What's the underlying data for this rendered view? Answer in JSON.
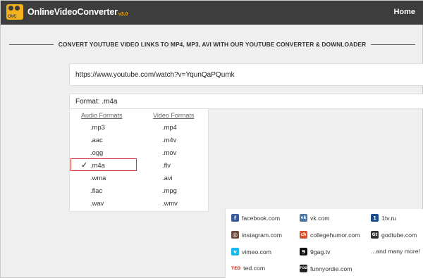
{
  "header": {
    "logo": {
      "badge": "OVC",
      "name": "OnlineVideoConverter",
      "version": "v3.0"
    },
    "nav_home": "Home",
    "badge_color": "#f3b11b",
    "bar_color": "#3d3d3d"
  },
  "headline": "CONVERT YOUTUBE VIDEO LINKS TO MP4, MP3, AVI WITH OUR YOUTUBE CONVERTER & DOWNLOADER",
  "url_input": {
    "value": "https://www.youtube.com/watch?v=YqunQaPQumk"
  },
  "format_select": {
    "label": "Format: .m4a",
    "selected": ".m4a"
  },
  "format_panel": {
    "audio_heading": "Audio Formats",
    "video_heading": "Video Formats",
    "audio": [
      ".mp3",
      ".aac",
      ".ogg",
      ".m4a",
      ".wma",
      ".flac",
      ".wav"
    ],
    "video": [
      ".mp4",
      ".m4v",
      ".mov",
      ".flv",
      ".avi",
      ".mpg",
      ".wmv"
    ],
    "check_mark": "✓",
    "highlight_color": "#d9382f"
  },
  "sites": [
    {
      "label": "facebook.com",
      "icon": "facebook-icon",
      "glyph": "f",
      "color": "#3b5998"
    },
    {
      "label": "vk.com",
      "icon": "vk-icon",
      "glyph": "vk",
      "color": "#4c75a3"
    },
    {
      "label": "1tv.ru",
      "icon": "1tv-icon",
      "glyph": "1",
      "color": "#1b4c8c"
    },
    {
      "label": "instagram.com",
      "icon": "instagram-icon",
      "glyph": "◎",
      "color": "#6b4a3a"
    },
    {
      "label": "collegehumor.com",
      "icon": "collegehumor-icon",
      "glyph": "ch",
      "color": "#d6502a"
    },
    {
      "label": "godtube.com",
      "icon": "godtube-icon",
      "glyph": "Gt",
      "color": "#333333"
    },
    {
      "label": "vimeo.com",
      "icon": "vimeo-icon",
      "glyph": "v",
      "color": "#1ab7ea"
    },
    {
      "label": "9gag.tv",
      "icon": "9gag-icon",
      "glyph": "9",
      "color": "#111111"
    },
    {
      "label": "...and many more!",
      "icon": "",
      "glyph": "",
      "color": ""
    },
    {
      "label": "ted.com",
      "icon": "ted-icon",
      "glyph": "TED",
      "color": "#e62b1e"
    },
    {
      "label": "funnyordie.com",
      "icon": "funnyordie-icon",
      "glyph": "FOD",
      "color": "#222222"
    }
  ]
}
